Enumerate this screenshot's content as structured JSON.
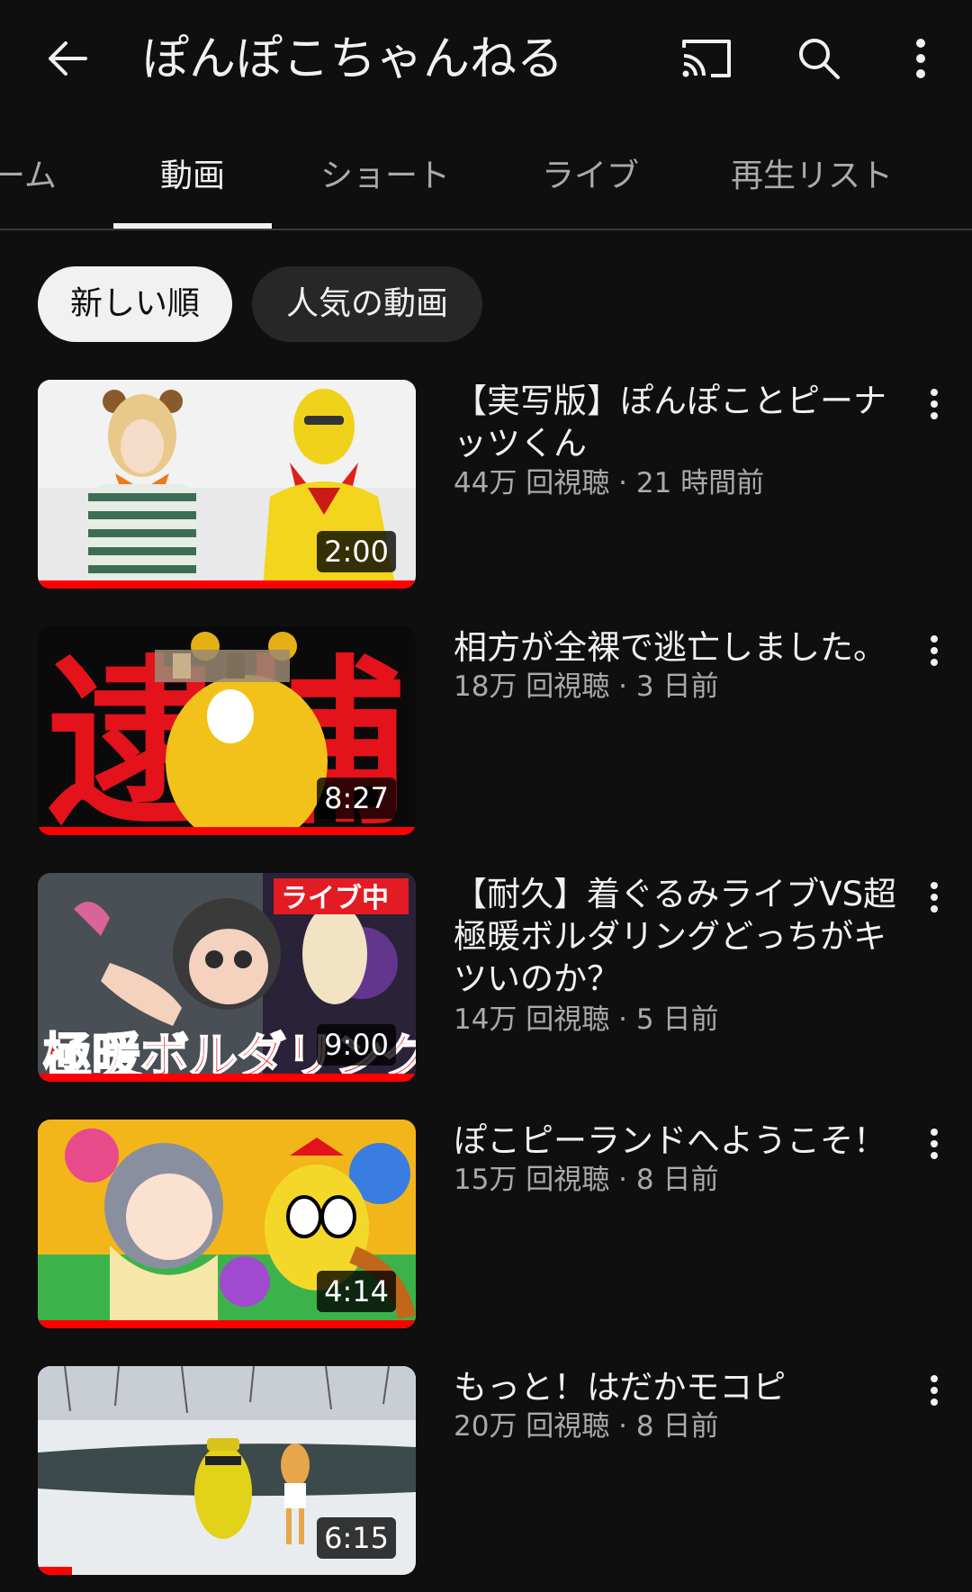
{
  "header": {
    "title": "ぽんぽこちゃんねる",
    "back_icon": "arrow-left-icon",
    "cast_icon": "cast-icon",
    "search_icon": "search-icon",
    "more_icon": "more-vertical-icon"
  },
  "tabs": [
    {
      "label": "ーム",
      "active": false
    },
    {
      "label": "動画",
      "active": true
    },
    {
      "label": "ショート",
      "active": false
    },
    {
      "label": "ライブ",
      "active": false
    },
    {
      "label": "再生リスト",
      "active": false
    }
  ],
  "chips": [
    {
      "label": "新しい順",
      "selected": true
    },
    {
      "label": "人気の動画",
      "selected": false
    }
  ],
  "videos": [
    {
      "title": "【実写版】ぽんぽことピーナッツくん",
      "meta": "44万 回視聴 · 21 時間前",
      "duration": "2:00",
      "watched_fraction": 1.0
    },
    {
      "title": "相方が全裸で逃亡しました。",
      "meta": "18万 回視聴 · 3 日前",
      "duration": "8:27",
      "watched_fraction": 1.0,
      "thumb_text": "逮捕"
    },
    {
      "title": "【耐久】着ぐるみライブVS超極暖ボルダリングどっちがキツいのか？",
      "meta": "14万 回視聴 · 5 日前",
      "duration": "9:00",
      "watched_fraction": 1.0,
      "thumb_text": "極暖ボルダリング",
      "thumb_badge": "ライブ中"
    },
    {
      "title": "ぽこピーランドへようこそ！",
      "meta": "15万 回視聴 · 8 日前",
      "duration": "4:14",
      "watched_fraction": 1.0
    },
    {
      "title": "もっと！はだかモコピ",
      "meta": "20万 回視聴 · 8 日前",
      "duration": "6:15",
      "watched_fraction": 0.09
    }
  ],
  "colors": {
    "background": "#0f0f0f",
    "progress": "#ff0000",
    "meta_text": "#aaaaaa"
  }
}
